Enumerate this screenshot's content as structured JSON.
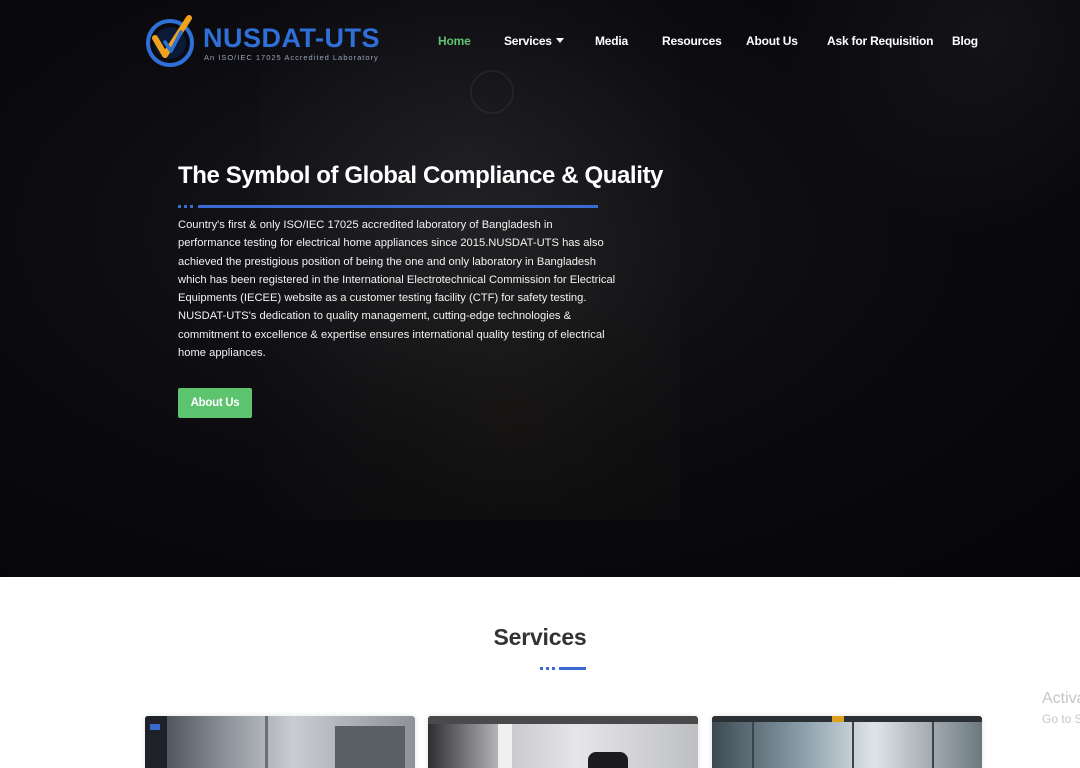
{
  "header": {
    "logo": {
      "name": "NUSDAT-UTS",
      "tagline": "An ISO/IEC 17025  Accredited Laboratory",
      "colors": {
        "primary": "#2f6fd8",
        "check": "#f0a21c"
      }
    },
    "nav": [
      {
        "label": "Home",
        "active": true
      },
      {
        "label": "Services",
        "has_dropdown": true
      },
      {
        "label": "Media"
      },
      {
        "label": "Resources"
      },
      {
        "label": "About Us"
      },
      {
        "label": "Ask for Requisition"
      },
      {
        "label": "Blog"
      }
    ]
  },
  "hero": {
    "title": "The Symbol of Global Compliance & Quality",
    "description": "Country's first & only ISO/IEC 17025 accredited laboratory of Bangladesh in performance testing for electrical home appliances since 2015.NUSDAT-UTS has also achieved the prestigious position of being the one and only laboratory in Bangladesh which has been registered in the International Electrotechnical Commission for Electrical Equipments (IECEE) website as a customer testing facility (CTF) for safety testing. NUSDAT-UTS's dedication to quality management, cutting-edge technologies & commitment to excellence & expertise ensures international quality testing of electrical home appliances.",
    "button_label": "About Us"
  },
  "services": {
    "title": "Services",
    "cards": [
      {
        "icon": "lab-equipment-image"
      },
      {
        "icon": "test-chamber-image"
      },
      {
        "icon": "facility-interior-image"
      }
    ]
  },
  "watermark": {
    "line1": "Activa",
    "line2": "Go to Se"
  },
  "colors": {
    "accent_green": "#5cc36e",
    "accent_blue": "#3a6bd0",
    "hero_background": "#0a0a0d"
  }
}
